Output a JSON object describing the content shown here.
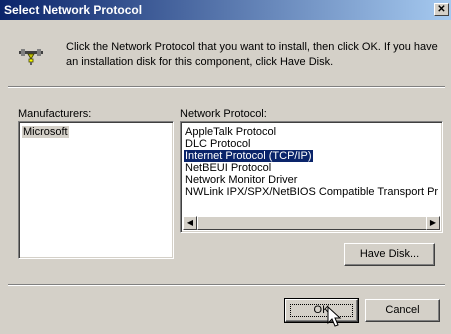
{
  "window": {
    "title": "Select Network Protocol",
    "close_glyph": "✕"
  },
  "instruction": "Click the Network Protocol that you want to install, then click OK. If you have an installation disk for this component, click Have Disk.",
  "manufacturers": {
    "label": "Manufacturers:",
    "items": [
      "Microsoft"
    ],
    "selected": "Microsoft"
  },
  "protocols": {
    "label": "Network Protocol:",
    "items": [
      "AppleTalk Protocol",
      "DLC Protocol",
      "Internet Protocol (TCP/IP)",
      "NetBEUI Protocol",
      "Network Monitor Driver",
      "NWLink IPX/SPX/NetBIOS Compatible Transport Pr"
    ],
    "selected": "Internet Protocol (TCP/IP)"
  },
  "scrollbar": {
    "left_arrow": "◀",
    "right_arrow": "▶"
  },
  "buttons": {
    "have_disk": "Have Disk...",
    "ok": "OK",
    "cancel": "Cancel"
  },
  "colors": {
    "titlebar_start": "#0a246a",
    "titlebar_end": "#a6caf0",
    "selection": "#0a246a",
    "window_bg": "#d4d0c8"
  },
  "icons": {
    "network": "network-protocol-icon",
    "cursor": "mouse-pointer-icon"
  }
}
